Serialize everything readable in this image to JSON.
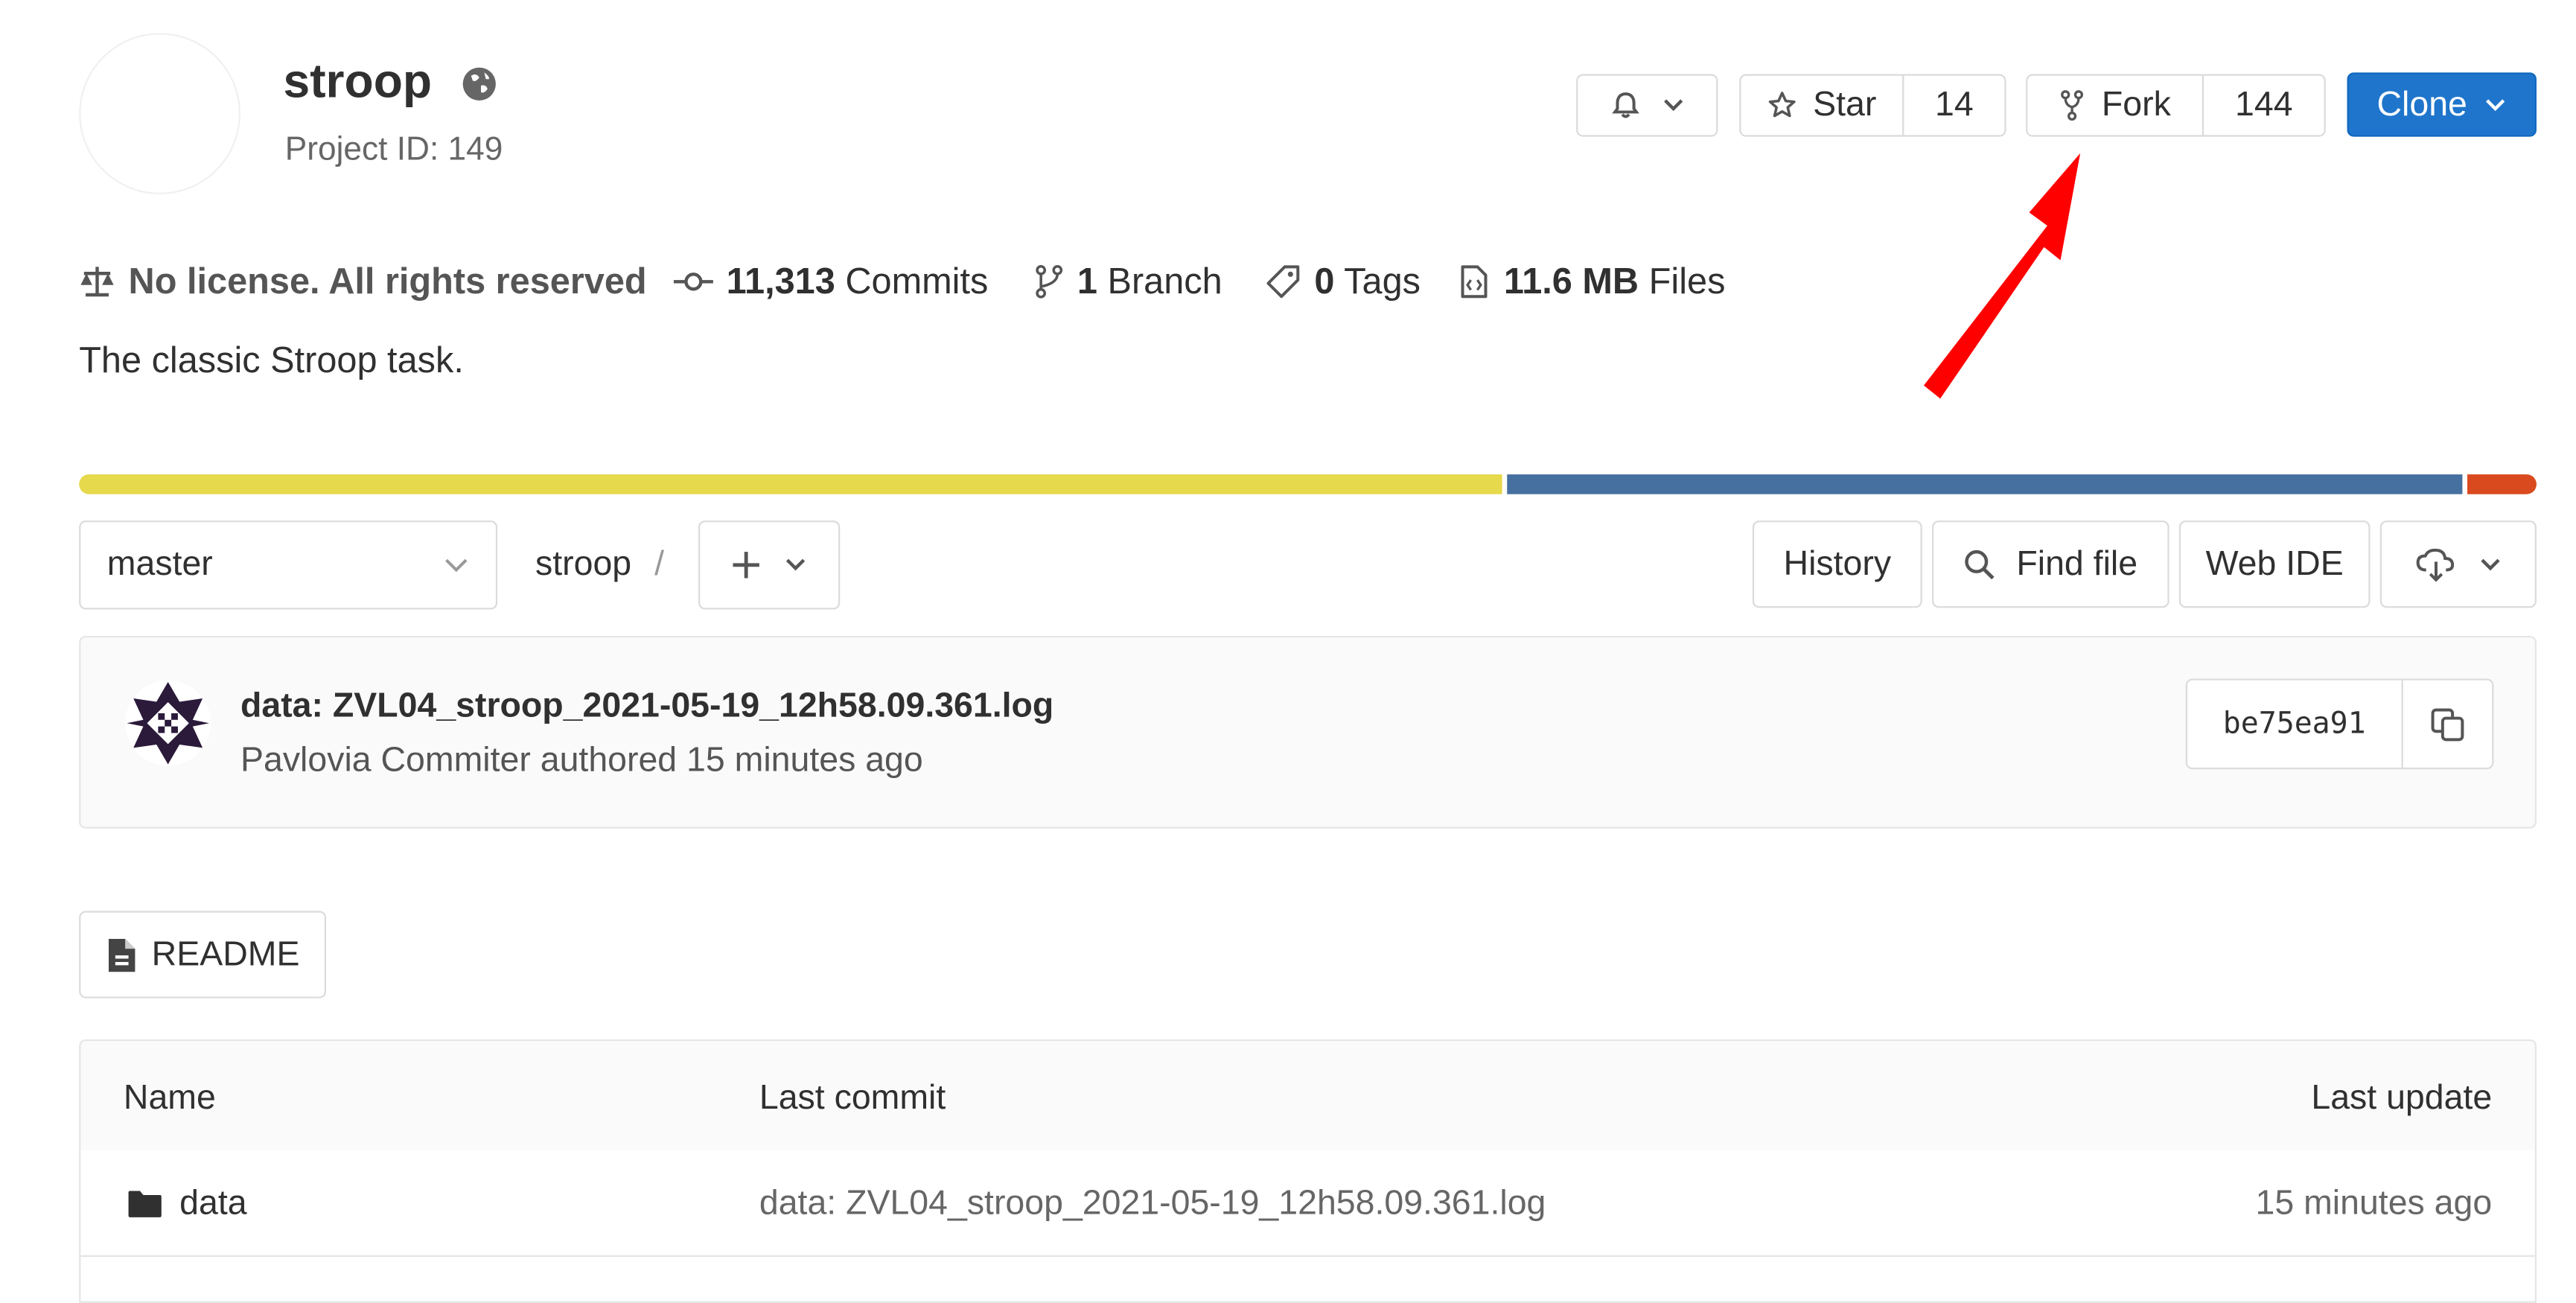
{
  "project": {
    "name": "stroop",
    "project_id": "Project ID: 149",
    "description": "The classic Stroop task."
  },
  "actions": {
    "star_label": "Star",
    "star_count": "14",
    "fork_label": "Fork",
    "fork_count": "144",
    "clone_label": "Clone"
  },
  "stats": {
    "license": "No license. All rights reserved",
    "commits_count": "11,313",
    "commits_label": "Commits",
    "branch_count": "1",
    "branch_label": "Branch",
    "tags_count": "0",
    "tags_label": "Tags",
    "files_size": "11.6 MB",
    "files_label": "Files"
  },
  "language_bar": {
    "segments": [
      {
        "color": "#e6d94b",
        "share": 0.58
      },
      {
        "color": "#46709f",
        "share": 0.39
      },
      {
        "color": "#d94a1e",
        "share": 0.03
      }
    ]
  },
  "toolbar": {
    "branch": "master",
    "path_root": "stroop",
    "path_sep": "/",
    "history_label": "History",
    "find_file_label": "Find file",
    "web_ide_label": "Web IDE"
  },
  "last_commit": {
    "message": "data: ZVL04_stroop_2021-05-19_12h58.09.361.log",
    "author_line": "Pavlovia Commiter authored 15 minutes ago",
    "sha": "be75ea91"
  },
  "readme_label": "README",
  "file_table": {
    "headers": {
      "name": "Name",
      "last_commit": "Last commit",
      "last_update": "Last update"
    },
    "rows": [
      {
        "name": "data",
        "last_commit": "data: ZVL04_stroop_2021-05-19_12h58.09.361.log",
        "last_update": "15 minutes ago"
      }
    ]
  },
  "annotation": {
    "color": "#ff0000"
  }
}
